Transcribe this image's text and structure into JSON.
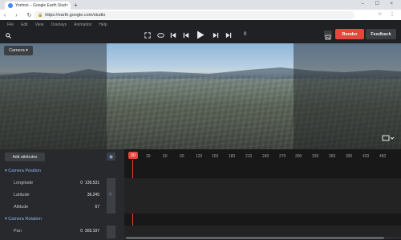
{
  "browser": {
    "tab_title": "Yorimoi – Google Earth Studio",
    "url": "https://earth.google.com/studio",
    "new_tab": "+",
    "tab_close": "×",
    "window_controls": "– ☐ ×",
    "nav": "‹ › ↻",
    "lock": "🔒",
    "tb_right": "☆ ⋮"
  },
  "menu": [
    "File",
    "Edit",
    "View",
    "Overlays",
    "Animation",
    "Help"
  ],
  "controls": {
    "frame": "0",
    "render": "Render",
    "feedback": "Feedback"
  },
  "viewport": {
    "camera_label": "Camera ▾"
  },
  "panel": {
    "add_attributes": "Add attributes",
    "sections": [
      {
        "title": "Camera Position",
        "attrs": [
          {
            "label": "Longitude",
            "value": "139.531"
          },
          {
            "label": "Latitude",
            "value": "36.245"
          },
          {
            "label": "Altitude",
            "value": "67"
          }
        ]
      },
      {
        "title": "Camera Rotation",
        "attrs": [
          {
            "label": "Pan",
            "value": "303.197"
          }
        ]
      }
    ],
    "small_zero": "0"
  },
  "timeline": {
    "current": "00",
    "ticks": [
      "30",
      "60",
      "90",
      "120",
      "150",
      "180",
      "210",
      "240",
      "270",
      "300",
      "330",
      "360",
      "390",
      "420",
      "450"
    ]
  },
  "colors": {
    "accent": "#e8453c",
    "panel": "#28292c",
    "link": "#8ab4f8"
  }
}
